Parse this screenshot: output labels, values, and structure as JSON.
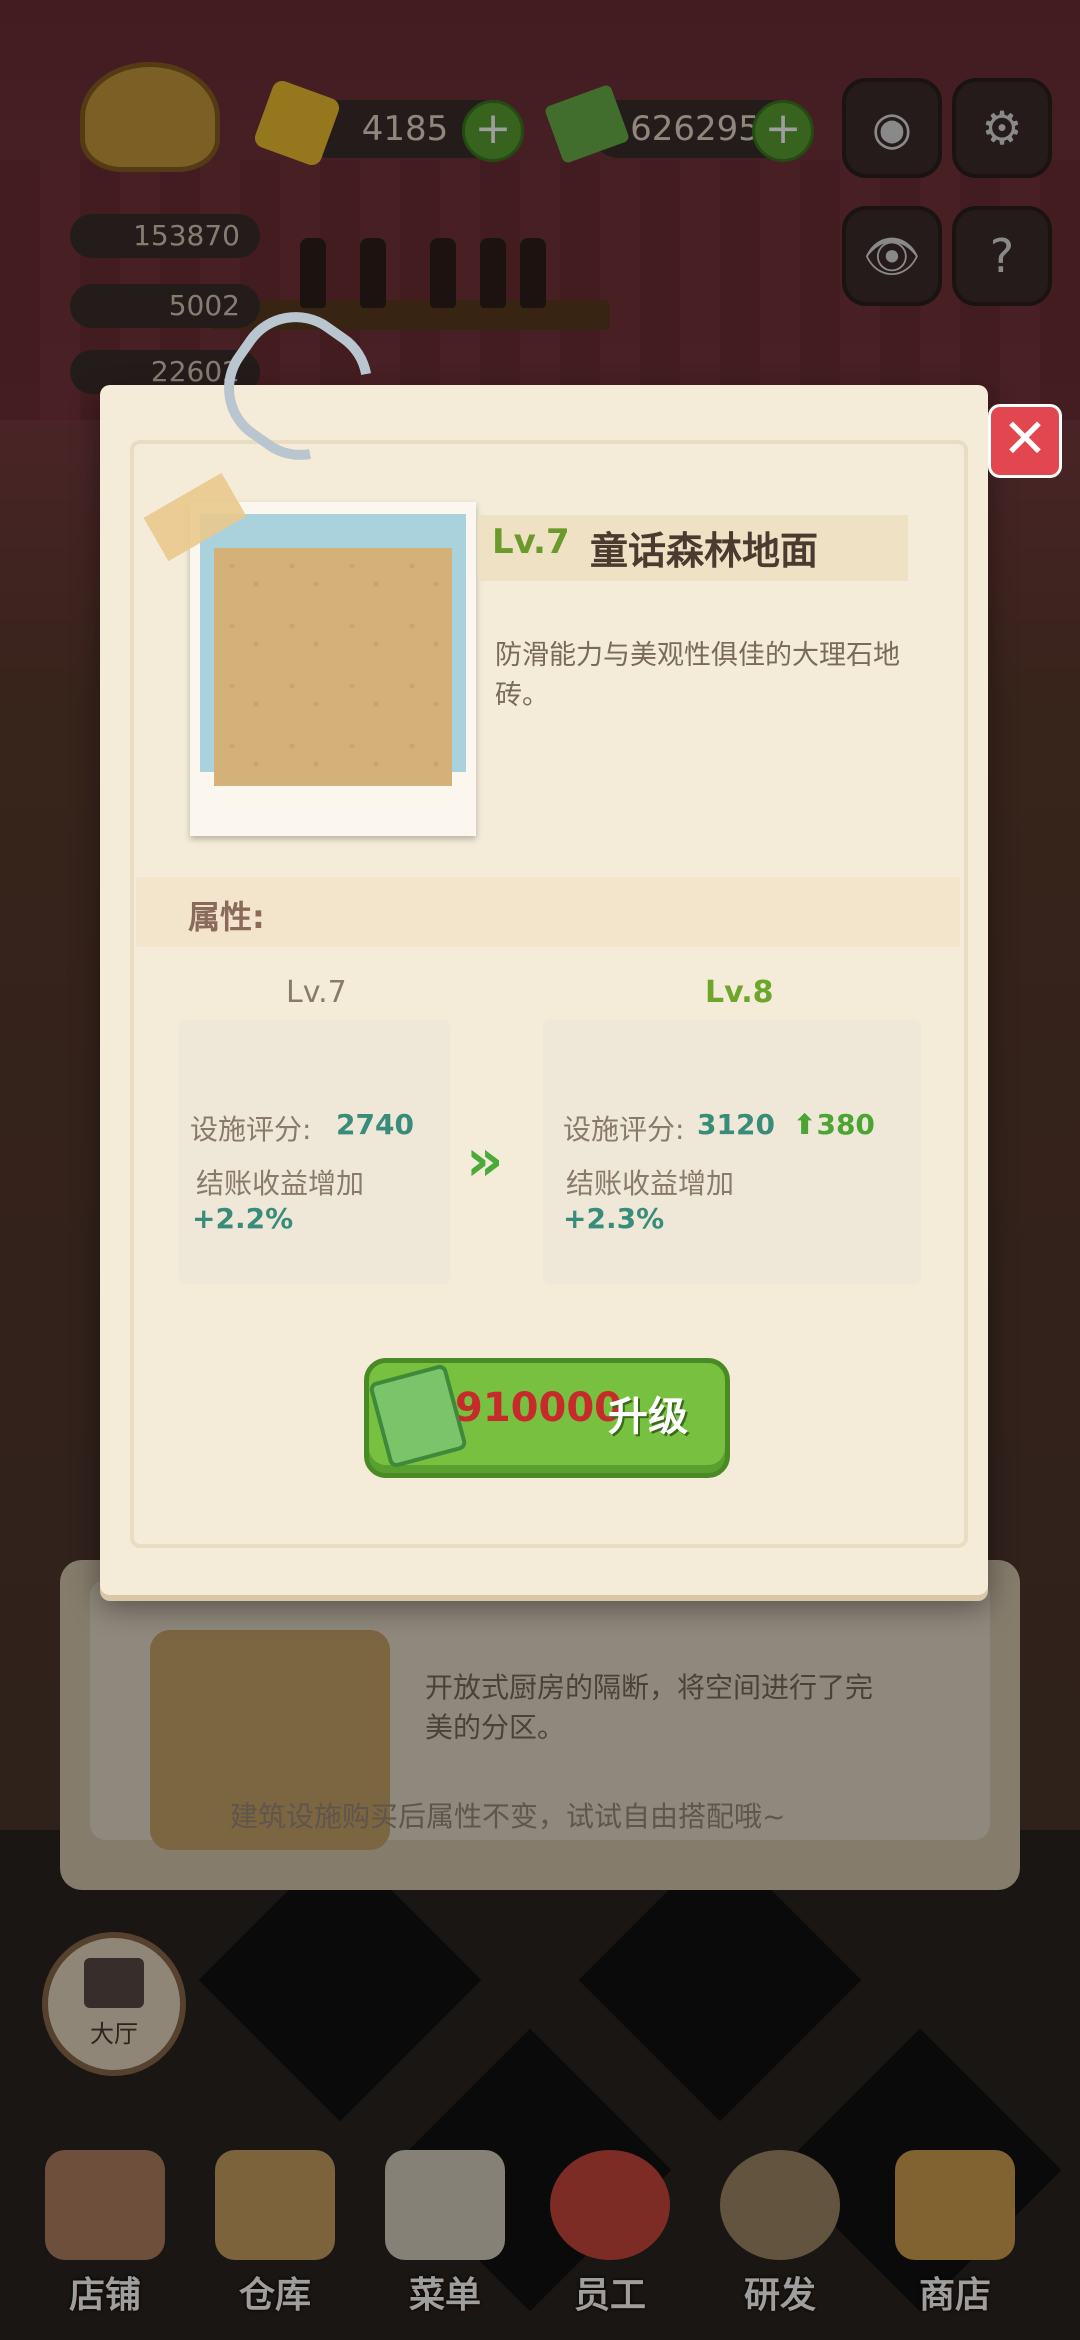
{
  "hud": {
    "gems": "4185",
    "cash": "626295",
    "stat1": "153870",
    "stat2": "5002",
    "stat3": "22602"
  },
  "modal": {
    "level": "Lv.7",
    "item_name": "童话森林地面",
    "description": "防滑能力与美观性俱佳的大理石地砖。",
    "attributes_label": "属性:",
    "current": {
      "level": "Lv.7",
      "score_label": "设施评分:",
      "score": "2740",
      "income_label": "结账收益增加",
      "income": "+2.2%"
    },
    "next": {
      "level": "Lv.8",
      "score_label": "设施评分:",
      "score": "3120",
      "score_delta": "380",
      "income_label": "结账收益增加",
      "income": "+2.3%"
    },
    "upgrade_cost": "910000",
    "upgrade_label": "升级",
    "close": "✕"
  },
  "background_panel": {
    "description": "开放式厨房的隔断，将空间进行了完美的分区。",
    "hint": "建筑设施购买后属性不变，试试自由搭配哦~"
  },
  "hall_button": "大厅",
  "nav": [
    "店铺",
    "仓库",
    "菜单",
    "员工",
    "研发",
    "商店"
  ],
  "colors": {
    "accent_green": "#78c040",
    "level_green": "#6c9a2a",
    "close_red": "#e2474f",
    "cost_red": "#c62a2a"
  }
}
